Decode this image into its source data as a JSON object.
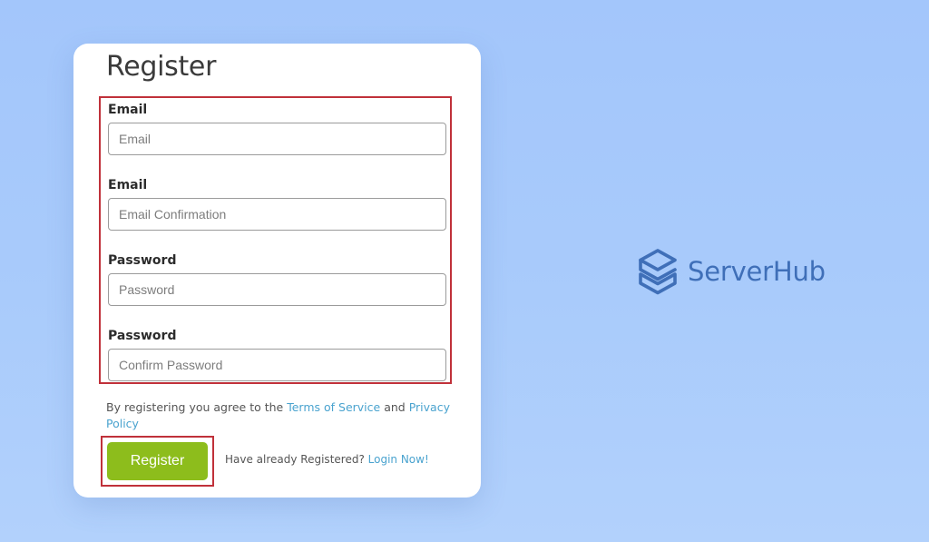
{
  "form": {
    "title": "Register",
    "fields": [
      {
        "label": "Email",
        "placeholder": "Email",
        "value": ""
      },
      {
        "label": "Email",
        "placeholder": "Email Confirmation",
        "value": ""
      },
      {
        "label": "Password",
        "placeholder": "Password",
        "value": ""
      },
      {
        "label": "Password",
        "placeholder": "Confirm Password",
        "value": ""
      }
    ],
    "terms": {
      "prefix": "By registering you agree to the ",
      "terms_link": "Terms of Service",
      "middle": " and ",
      "privacy_link": "Privacy Policy"
    },
    "register_label": "Register",
    "already_text": "Have already Registered? ",
    "login_link": "Login Now!"
  },
  "brand": {
    "name": "ServerHub",
    "logo_icon": "stacked-layers-icon"
  },
  "colors": {
    "background": "#a9cbfb",
    "register_button": "#8dbd1c",
    "link": "#4aa3cf",
    "highlight_border": "#c0313a",
    "brand": "#3f6fb8"
  }
}
